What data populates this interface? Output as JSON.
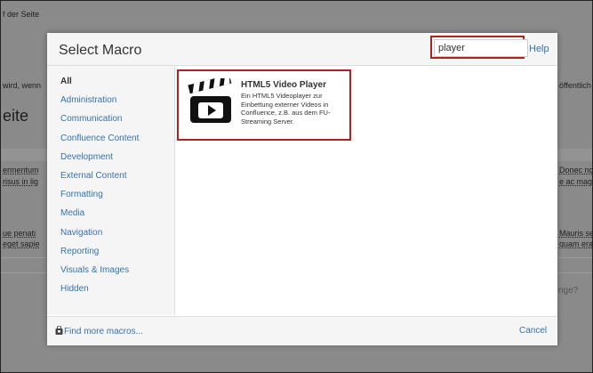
{
  "background": {
    "fragments": {
      "der_seite": "f der Seite",
      "wird_wenn": "wird, wenn",
      "oeffentlich": "öffentlich",
      "seite": "eite",
      "fermentum": "ermentum",
      "donec": "Donec nc",
      "risus": "risus in lig",
      "ac_magn": "e ac magn",
      "penati": "ue penati",
      "mauris": "Mauris sed",
      "sapie": "eget sapie",
      "quam": "quam erat",
      "nge": "nge?"
    }
  },
  "dialog": {
    "title": "Select Macro",
    "search": {
      "value": "player"
    },
    "help_label": "Help",
    "categories": [
      "All",
      "Administration",
      "Communication",
      "Confluence Content",
      "Development",
      "External Content",
      "Formatting",
      "Media",
      "Navigation",
      "Reporting",
      "Visuals & Images",
      "Hidden"
    ],
    "active_category": "All",
    "results": [
      {
        "name": "HTML5 Video Player",
        "description": "Ein HTML5 Videoplayer zur Einbettung externer Videos in Confluence, z.B. aus dem FU-Streaming Server.",
        "icon": "clapperboard-icon"
      }
    ],
    "footer": {
      "more_label": "Find more macros...",
      "cancel_label": "Cancel"
    }
  },
  "colors": {
    "link": "#3572b0",
    "highlight": "#b32020"
  }
}
